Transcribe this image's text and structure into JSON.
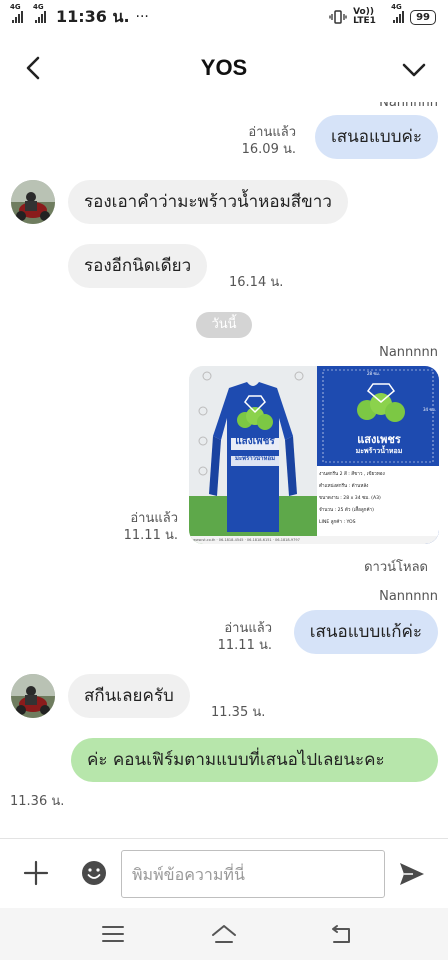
{
  "status_bar": {
    "network_1": "4G",
    "network_2": "4G",
    "time": "11:36 น.",
    "more": "···",
    "volte": "Vo)) LTE1",
    "network_3": "4G",
    "battery": "99"
  },
  "header": {
    "title": "YOS"
  },
  "messages": [
    {
      "id": "m0",
      "type": "sender",
      "text": "Nannnnn"
    },
    {
      "id": "m1",
      "type": "out",
      "text": "เสนอแบบค่ะ",
      "read": "อ่านแล้ว",
      "time": "16.09 น."
    },
    {
      "id": "m2",
      "type": "in",
      "text": "รองเอาคำว่ามะพร้าวน้ำหอมสีขาว"
    },
    {
      "id": "m3",
      "type": "in",
      "text": "รองอีกนิดเดียว",
      "time": "16.14 น."
    },
    {
      "id": "d1",
      "type": "date",
      "text": "วันนี้"
    },
    {
      "id": "m4",
      "type": "image",
      "sender": "Nannnnn",
      "read": "อ่านแล้ว",
      "time": "11.11 น.",
      "download": "ดาวน์โหลด"
    },
    {
      "id": "m5",
      "type": "out",
      "sender": "Nannnnn",
      "text": "เสนอแบบแก้ค่ะ",
      "read": "อ่านแล้ว",
      "time": "11.11 น."
    },
    {
      "id": "m6",
      "type": "in",
      "text": "สกีนเลยครับ",
      "time": "11.35 น."
    },
    {
      "id": "m7",
      "type": "out",
      "text": "ค่ะ คอนเฟิร์มตามแบบที่เสนอไปเลยนะคะ",
      "time": "11.36 น."
    }
  ],
  "image_card": {
    "logo_line1": "แสงเพชร",
    "logo_line2": "มะพร้าวน้ำหอม",
    "dim_width": "28 ซม.",
    "dim_height": "34 ซม.",
    "specs": [
      {
        "label": "งานสกรีน 2 สี",
        "value": ": สีขาว , เขียวทอง"
      },
      {
        "label": "ตำแหน่งสกรีน",
        "value": ": ด้านหลัง"
      },
      {
        "label": "ขนาดงาน",
        "value": ": 28 x 34 ซม. (A3)"
      },
      {
        "label": "จำนวน",
        "value": ": 25 ตัว (เสื้อลูกค้า)"
      },
      {
        "label": "LINE ลูกค้า",
        "value": ": YOS"
      }
    ],
    "footer": "www.st.co.th · 06-1818-4545 · 06-1818-6151 · 06-1818-9797"
  },
  "input": {
    "placeholder": "พิมพ์ข้อความที่นี่"
  },
  "colors": {
    "bubble_in": "#f0f0f0",
    "bubble_out": "#d6e3f8",
    "bubble_green": "#b7e6ab",
    "shirt_blue": "#1e4bb0"
  },
  "icons": {
    "back": "chevron-left-icon",
    "expand": "chevron-down-icon",
    "plus": "plus-icon",
    "emoji": "emoji-icon",
    "send": "send-icon",
    "menu": "menu-icon",
    "home": "home-icon",
    "back_nav": "back-arrow-icon"
  }
}
